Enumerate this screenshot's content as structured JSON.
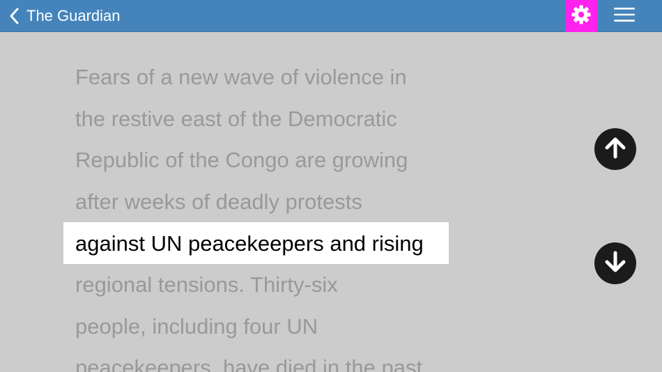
{
  "nav": {
    "title": "The Guardian",
    "bar_color": "#4584bb",
    "settings_highlight_color": "#ff22ee",
    "icons": {
      "back": "chevron-left-icon",
      "settings": "gear-icon",
      "menu": "hamburger-menu-icon"
    }
  },
  "reader": {
    "background": "#cccccc",
    "lines": [
      " Fears of a new wave of violence in",
      "the restive east of the Democratic",
      "Republic of the Congo are growing",
      "after weeks of deadly protests",
      "against UN peacekeepers and rising",
      "regional tensions. Thirty-six",
      "people, including four UN",
      "peacekeepers, have died in the past"
    ],
    "highlighted_line_index": 4,
    "controls": {
      "up": "arrow-up-icon",
      "down": "arrow-down-icon"
    }
  }
}
